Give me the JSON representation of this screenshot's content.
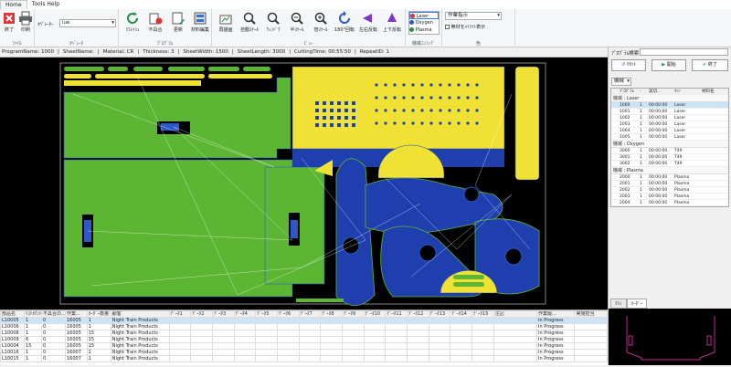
{
  "menu": {
    "tabs": [
      "Home",
      "Tools Help"
    ]
  },
  "ribbon": {
    "file_group": {
      "label": "ﾌｧｲﾙ",
      "buttons": [
        "終了",
        "印刷"
      ]
    },
    "operator_group": {
      "label": "ｵﾍﾟﾚｰﾀ",
      "operator_label": "ｵﾍﾟﾚｰﾀｰ",
      "operator_value": "iue"
    },
    "program_group": {
      "label": "ﾌﾟﾛｸﾞﾗﾑ",
      "buttons": [
        "ﾘﾌﾚｯｼｭ",
        "不具合",
        "更新",
        "材料編集"
      ]
    },
    "view_group": {
      "label": "ﾋﾞｭｰ",
      "buttons": [
        "再描画",
        "自動ｽｹｰﾙ",
        "ｳｨﾝﾄﾞｳ",
        "半ｽｹｰﾙ",
        "倍ｽｹｰﾙ",
        "180°回転",
        "左右反転",
        "上下反転"
      ]
    },
    "machine_group": {
      "label": "機械ｺﾝﾌｨｸﾞ",
      "options": [
        "Laser",
        "Oxygen",
        "Plasma"
      ]
    },
    "color_group": {
      "label": "色",
      "select_value": "作業指示",
      "checkbox_label": "無材をﾊｲﾗｲﾄ表示"
    }
  },
  "status": {
    "program_name": "ProgramName: 1000",
    "sheet_name": "SheetName:",
    "material": "Material: CR",
    "thickness": "Thickness: 3",
    "sheet_width": "SheetWidth: 1500",
    "sheet_length": "SheetLength: 3000",
    "cutting_time": "CuttingTime: 00:55:50",
    "repeat_id": "RepeatID: 1"
  },
  "right_panel": {
    "search_label": "ﾌﾟﾛｸﾞﾗﾑ検索:",
    "reset_label": "ﾘｾｯﾄ",
    "start_label": "開始",
    "end_label": "終了",
    "machine_combo": "機械",
    "columns": [
      "ﾌﾟﾛｸﾞﾗﾑ",
      "-",
      "実切...",
      "ﾏｼﾝ",
      "材料名"
    ],
    "groups": [
      {
        "name": "機械 : Laser",
        "rows": [
          {
            "prog": "1000",
            "n": "1",
            "time": "00:00:00",
            "machine": "Laser"
          },
          {
            "prog": "1001",
            "n": "1",
            "time": "00:00:00",
            "machine": "Laser"
          },
          {
            "prog": "1002",
            "n": "1",
            "time": "00:00:00",
            "machine": "Laser"
          },
          {
            "prog": "1003",
            "n": "1",
            "time": "00:00:00",
            "machine": "Laser"
          },
          {
            "prog": "1004",
            "n": "1",
            "time": "00:00:00",
            "machine": "Laser"
          },
          {
            "prog": "1005",
            "n": "1",
            "time": "00:00:00",
            "machine": "Laser"
          }
        ]
      },
      {
        "name": "機械 : Oxygen",
        "rows": [
          {
            "prog": "3000",
            "n": "1",
            "time": "00:00:00",
            "machine": "T49"
          },
          {
            "prog": "3001",
            "n": "1",
            "time": "00:00:00",
            "machine": "T49"
          },
          {
            "prog": "3002",
            "n": "1",
            "time": "00:00:00",
            "machine": "T49"
          }
        ]
      },
      {
        "name": "機械 : Plasma",
        "rows": [
          {
            "prog": "2000",
            "n": "1",
            "time": "00:00:00",
            "machine": "Plasma"
          },
          {
            "prog": "2001",
            "n": "1",
            "time": "00:00:00",
            "machine": "Plasma"
          },
          {
            "prog": "2002",
            "n": "1",
            "time": "00:00:00",
            "machine": "Plasma"
          },
          {
            "prog": "2003",
            "n": "1",
            "time": "00:00:00",
            "machine": "Plasma"
          },
          {
            "prog": "2004",
            "n": "1",
            "time": "00:00:00",
            "machine": "Plasma"
          }
        ]
      }
    ],
    "bottom_tabs": [
      "ﾏｼﾝ",
      "ｵｰﾀﾞｰ"
    ]
  },
  "grid": {
    "columns": [
      "部品名",
      "ﾘｽﾄｶｳﾝﾄ",
      "不具合の...",
      "作業...",
      "ｵｰﾀﾞｰ数量",
      "顧客",
      "ﾃﾞｰﾀ1",
      "ﾃﾞｰﾀ2",
      "ﾃﾞｰﾀ3",
      "ﾃﾞｰﾀ4",
      "ﾃﾞｰﾀ5",
      "ﾃﾞｰﾀ6",
      "ﾃﾞｰﾀ7",
      "ﾃﾞｰﾀ8",
      "ﾃﾞｰﾀ9",
      "ﾃﾞｰﾀ10",
      "ﾃﾞｰﾀ11",
      "ﾃﾞｰﾀ12",
      "ﾃﾞｰﾀ13",
      "ﾃﾞｰﾀ14",
      "ﾃﾞｰﾀ15",
      "注記",
      "作業履...",
      "実施担当"
    ],
    "rows": [
      {
        "part": "L10005",
        "cnt": "1",
        "err": "0",
        "wk": "16005",
        "qty": "1",
        "cust": "Night Train Products",
        "status": "In Progress"
      },
      {
        "part": "L10006",
        "cnt": "1",
        "err": "0",
        "wk": "16005",
        "qty": "1",
        "cust": "Night Train Products",
        "status": "In Progress"
      },
      {
        "part": "L10008",
        "cnt": "1",
        "err": "0",
        "wk": "16005",
        "qty": "15",
        "cust": "Night Train Products",
        "status": "In Progress"
      },
      {
        "part": "L10009",
        "cnt": "6",
        "err": "0",
        "wk": "16005",
        "qty": "15",
        "cust": "Night Train Products",
        "status": "In Progress"
      },
      {
        "part": "L10004",
        "cnt": "15",
        "err": "0",
        "wk": "16005",
        "qty": "15",
        "cust": "Night Train Products",
        "status": "In Progress"
      },
      {
        "part": "L10016",
        "cnt": "1",
        "err": "0",
        "wk": "16007",
        "qty": "1",
        "cust": "Night Train Products",
        "status": "In Progress"
      },
      {
        "part": "L10015",
        "cnt": "1",
        "err": "0",
        "wk": "16007",
        "qty": "1",
        "cust": "Night Train Products",
        "status": "In Progress"
      }
    ]
  },
  "colors": {
    "part_green": "#5db534",
    "part_yellow": "#f0e234",
    "part_blue": "#1f3fae",
    "sheet_black": "#000000"
  }
}
